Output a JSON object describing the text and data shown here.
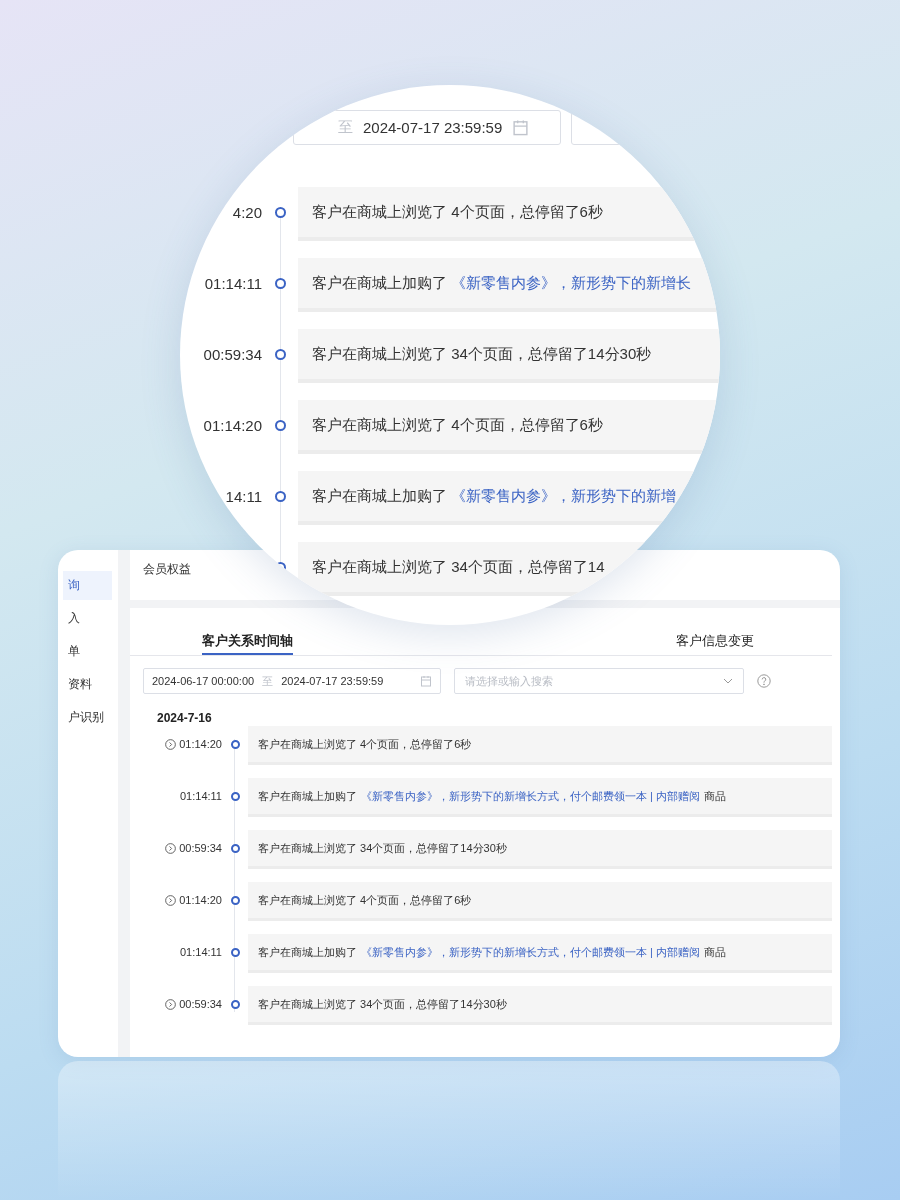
{
  "magnifier": {
    "date_separator": "至",
    "date_end": "2024-07-17 23:59:59",
    "rows": [
      {
        "time": "4:20",
        "text": "客户在商城上浏览了 4个页面，总停留了6秒"
      },
      {
        "time": "01:14:11",
        "text": "客户在商城上加购了",
        "link": "《新零售内参》，新形势下的新增长"
      },
      {
        "time": "00:59:34",
        "text": "客户在商城上浏览了 34个页面，总停留了14分30秒"
      },
      {
        "time": "01:14:20",
        "text": "客户在商城上浏览了 4个页面，总停留了6秒"
      },
      {
        "time": "14:11",
        "text": "客户在商城上加购了",
        "link": "《新零售内参》，新形势下的新增"
      },
      {
        "text": "客户在商城上浏览了 34个页面，总停留了14"
      }
    ]
  },
  "sidebar": {
    "items": [
      {
        "label": "询",
        "selected": true
      },
      {
        "label": "入",
        "selected": false
      },
      {
        "label": "单",
        "selected": false
      },
      {
        "label": "资料",
        "selected": false
      },
      {
        "label": "户识别",
        "selected": false
      }
    ]
  },
  "section_title": "会员权益",
  "tabs": [
    {
      "label": "客户关系时间轴",
      "selected": true
    },
    {
      "label": "客户信息变更",
      "selected": false
    }
  ],
  "filters": {
    "date_start": "2024-06-17 00:00:00",
    "date_separator": "至",
    "date_end": "2024-07-17 23:59:59",
    "search_placeholder": "请选择或输入搜索"
  },
  "timeline": {
    "date": "2024-7-16",
    "rows": [
      {
        "time": "01:14:20",
        "expandable": true,
        "text": "客户在商城上浏览了 4个页面，总停留了6秒"
      },
      {
        "time": "01:14:11",
        "expandable": false,
        "text": "客户在商城上加购了",
        "link": "《新零售内参》，新形势下的新增长方式，付个邮费领一本 | 内部赠阅",
        "suffix": "商品"
      },
      {
        "time": "00:59:34",
        "expandable": true,
        "text": "客户在商城上浏览了 34个页面，总停留了14分30秒"
      },
      {
        "time": "01:14:20",
        "expandable": true,
        "text": "客户在商城上浏览了 4个页面，总停留了6秒"
      },
      {
        "time": "01:14:11",
        "expandable": false,
        "text": "客户在商城上加购了",
        "link": "《新零售内参》，新形势下的新增长方式，付个邮费领一本 | 内部赠阅",
        "suffix": "商品"
      },
      {
        "time": "00:59:34",
        "expandable": true,
        "text": "客户在商城上浏览了 34个页面，总停留了14分30秒"
      }
    ]
  }
}
